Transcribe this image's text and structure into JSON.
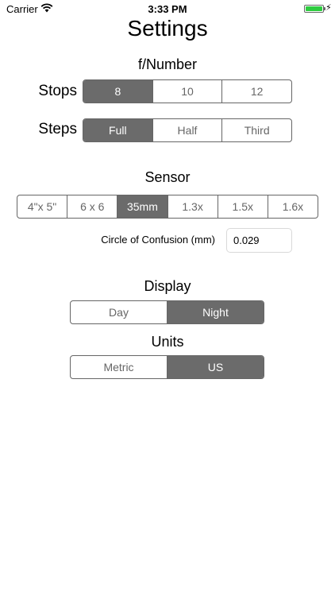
{
  "status_bar": {
    "carrier": "Carrier",
    "time": "3:33 PM"
  },
  "title": "Settings",
  "fnumber": {
    "heading": "f/Number",
    "stops": {
      "label": "Stops",
      "options": [
        "8",
        "10",
        "12"
      ],
      "selected": 0
    },
    "steps": {
      "label": "Steps",
      "options": [
        "Full",
        "Half",
        "Third"
      ],
      "selected": 0
    }
  },
  "sensor": {
    "heading": "Sensor",
    "options": [
      "4\"x 5\"",
      "6 x 6",
      "35mm",
      "1.3x",
      "1.5x",
      "1.6x"
    ],
    "selected": 2,
    "coc_label": "Circle of Confusion (mm)",
    "coc_value": "0.029"
  },
  "display": {
    "heading": "Display",
    "options": [
      "Day",
      "Night"
    ],
    "selected": 1
  },
  "units": {
    "heading": "Units",
    "options": [
      "Metric",
      "US"
    ],
    "selected": 1
  },
  "colors": {
    "selected_segment": "#6b6b6b",
    "border": "#666666",
    "battery": "#2ecc40"
  }
}
